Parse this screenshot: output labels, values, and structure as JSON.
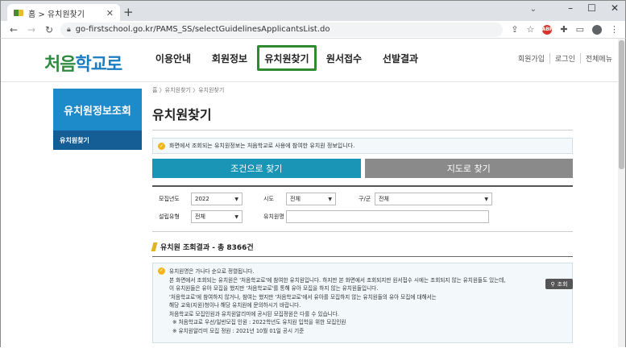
{
  "browser": {
    "tab_title": "홈 > 유치원찾기",
    "new_tab": "+",
    "url": "go-firstschool.go.kr/PAMS_SS/selectGuidelinesApplicantsList.do",
    "window_controls": [
      "–",
      "☐",
      "✕"
    ],
    "tab_chevron": "⌄"
  },
  "site": {
    "logo_main": "처음",
    "logo_accent": "학교로",
    "gnb": [
      "이용안내",
      "회원정보",
      "유치원찾기",
      "원서접수",
      "선발결과"
    ],
    "gnb_active_index": 2,
    "util": [
      "회원가입",
      "로그인",
      "전체메뉴"
    ]
  },
  "lnb": {
    "title": "유치원정보조회",
    "items": [
      "유치원찾기"
    ]
  },
  "content": {
    "breadcrumb": "홈 〉유치원찾기 〉유치원찾기",
    "page_title": "유치원찾기",
    "notice": "화면에서 조회되는 유치원정보는 처음학교로 사용에 참여한 유치원 정보입니다.",
    "tabs": [
      "조건으로 찾기",
      "지도로 찾기"
    ],
    "filters": {
      "year_label": "모집년도",
      "year_value": "2022",
      "sido_label": "시도",
      "sido_value": "전체",
      "gugun_label": "구/군",
      "gugun_value": "전체",
      "type_label": "설립유형",
      "type_value": "전체",
      "name_label": "유치원명",
      "name_value": ""
    },
    "search_button": "조회",
    "result_title": "유치원 조회결과 -",
    "result_count": "총 8366건",
    "info_lines": [
      "유치원명은 가나다 순으로 정렬됩니다.",
      "본 화면에서 조회되는 유치원은 '처음학교로'에 참여한 유치원입니다. 하지만 본 화면에서 조회되지만 원서접수 시에는 조회되지 않는 유치원들도 있는데,",
      "이 유치원들은 유아 모집을 했지만 '처음학교로'를 통해 유아 모집을 하지 않는 유치원들입니다.",
      "'처음학교로'에 참여하지 않거나, 참여는 했지만 '처음학교로'에서 유아를 모집하지 않는 유치원들의 유아 모집에 대해서는",
      "해당 교육(지원)청이나 해당 유치원에 문의하시기 바랍니다.",
      "처음학교로 모집인원과 유치원알리미에 공시된 모집정원은 다를 수 있습니다.",
      "※ 처음학교로 우선/일반모집 인원 : 2022학년도 유치원 입학을 위한 모집인원",
      "※ 유치원알리미 모집 정원 : 2021년 10월 01일 공시 기준"
    ]
  },
  "colors": {
    "active_outline": "#2f8a32",
    "lnb_title": "#1d8ac9",
    "lnb_item": "#145d95",
    "tab_on": "#1b95b5",
    "tab_off": "#8a8a8a"
  }
}
